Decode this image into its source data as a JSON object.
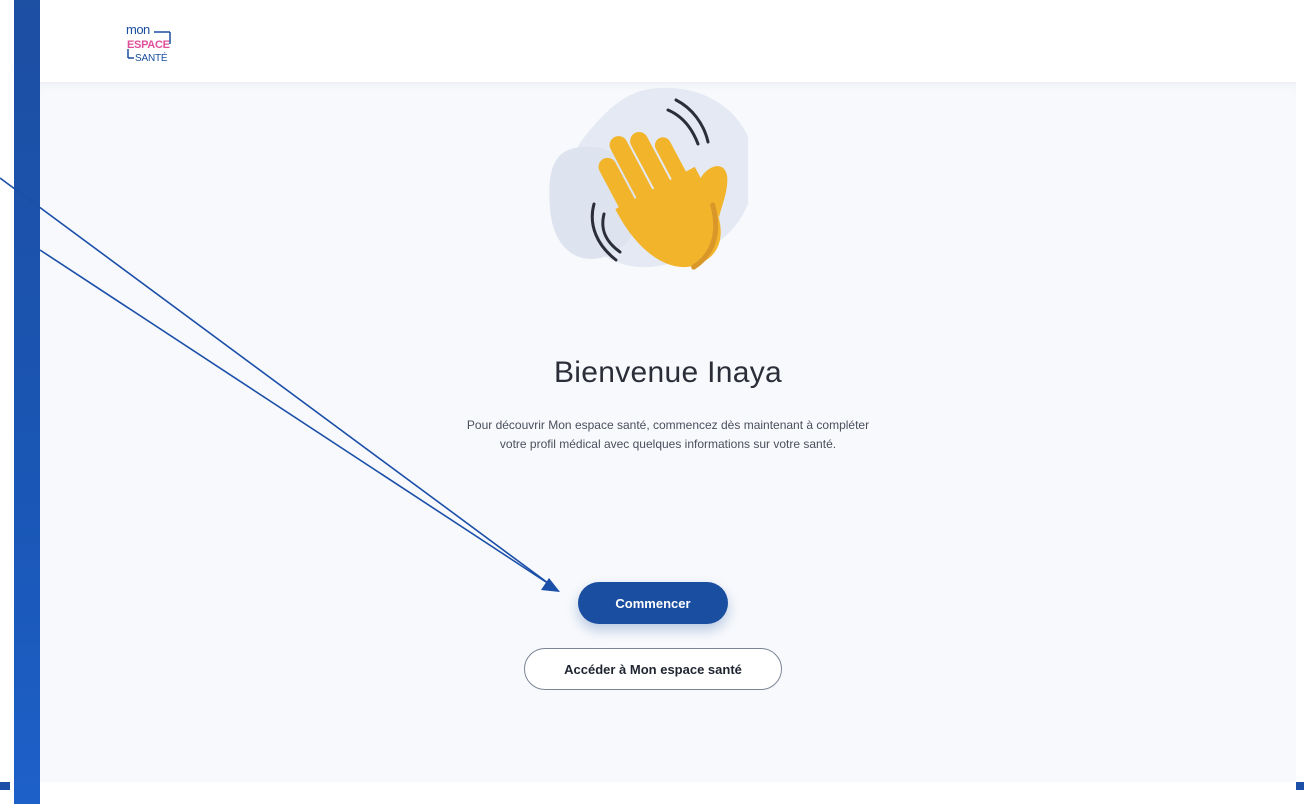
{
  "brand": {
    "logo_text": "mon ESPACE SANTÉ",
    "logo_colors": {
      "primary": "#1a4ea0",
      "accent": "#e04f9a"
    }
  },
  "welcome": {
    "illustration_icon": "waving-hand-icon",
    "title": "Bienvenue Inaya",
    "intro_line1": "Pour découvrir Mon espace santé, commencez dès maintenant à compléter",
    "intro_line2": "votre profil médical avec quelques informations sur votre santé."
  },
  "actions": {
    "start_label": "Commencer",
    "access_label": "Accéder à Mon espace santé"
  },
  "colors": {
    "primary_blue": "#1a4ea0",
    "hand_yellow": "#f2b42a",
    "blob": "#e4e9f3",
    "background": "#f7f9fc"
  }
}
